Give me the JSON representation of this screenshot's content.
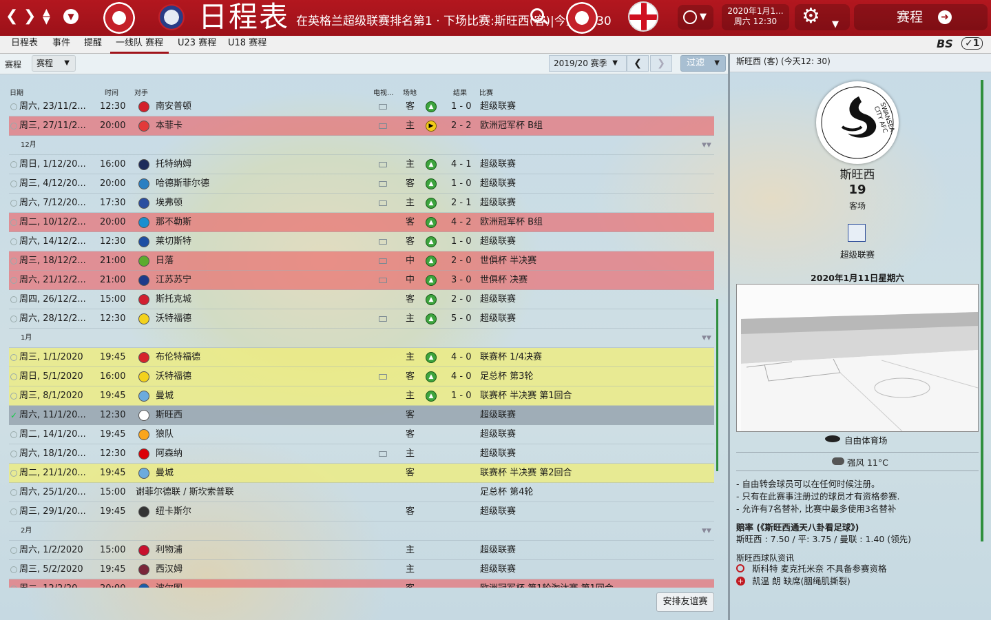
{
  "top": {
    "title": "日程表",
    "status": "在英格兰超级联赛排名第1 · 下场比赛:斯旺西(客)|今天12:30",
    "date_line1": "2020年1月1...",
    "date_line2": "周六 12:30",
    "continue_label": "赛程"
  },
  "tabs": [
    {
      "label": "日程表"
    },
    {
      "label": "事件"
    },
    {
      "label": "提醒"
    },
    {
      "label": "一线队 赛程"
    },
    {
      "label": "U23 赛程"
    },
    {
      "label": "U18 赛程"
    }
  ],
  "toolbar": {
    "view_label": "赛程",
    "view_dropdown": "赛程",
    "season": "2019/20 赛季",
    "filter_label": "过滤"
  },
  "columns": {
    "date": "日期",
    "time": "时间",
    "opponent": "对手",
    "tv": "电视...",
    "venue": "场地",
    "result": "结果",
    "competition": "比赛"
  },
  "rows": [
    {
      "date": "周六, 23/11/2...",
      "time": "12:30",
      "opp": "南安普顿",
      "color": "#d3202a",
      "tv": true,
      "venue": "客",
      "icon": "win",
      "score": "1 - 0",
      "comp": "超级联赛",
      "style": ""
    },
    {
      "date": "周三, 27/11/2...",
      "time": "20:00",
      "opp": "本菲卡",
      "color": "#e33a3a",
      "tv": true,
      "venue": "主",
      "icon": "draw",
      "score": "2 - 2",
      "comp": "欧洲冠军杯 B组",
      "style": "red"
    },
    {
      "month": "12月"
    },
    {
      "date": "周日, 1/12/20...",
      "time": "16:00",
      "opp": "托特纳姆",
      "color": "#1d2b5a",
      "tv": true,
      "venue": "主",
      "icon": "win",
      "score": "4 - 1",
      "comp": "超级联赛",
      "style": ""
    },
    {
      "date": "周三, 4/12/20...",
      "time": "20:00",
      "opp": "哈德斯菲尔德",
      "color": "#2a7fc2",
      "tv": true,
      "venue": "客",
      "icon": "win",
      "score": "1 - 0",
      "comp": "超级联赛",
      "style": ""
    },
    {
      "date": "周六, 7/12/20...",
      "time": "17:30",
      "opp": "埃弗顿",
      "color": "#2a4ea0",
      "tv": true,
      "venue": "主",
      "icon": "win",
      "score": "2 - 1",
      "comp": "超级联赛",
      "style": ""
    },
    {
      "date": "周二, 10/12/2...",
      "time": "20:00",
      "opp": "那不勒斯",
      "color": "#1a8fd0",
      "tv": false,
      "venue": "客",
      "icon": "win",
      "score": "4 - 2",
      "comp": "欧洲冠军杯 B组",
      "style": "red"
    },
    {
      "date": "周六, 14/12/2...",
      "time": "12:30",
      "opp": "莱切斯特",
      "color": "#1d4ea3",
      "tv": true,
      "venue": "客",
      "icon": "win",
      "score": "1 - 0",
      "comp": "超级联赛",
      "style": ""
    },
    {
      "date": "周三, 18/12/2...",
      "time": "21:00",
      "opp": "日落",
      "color": "#5cab2e",
      "tv": true,
      "venue": "中",
      "icon": "win",
      "score": "2 - 0",
      "comp": "世俱杯 半决赛",
      "style": "red"
    },
    {
      "date": "周六, 21/12/2...",
      "time": "21:00",
      "opp": "江苏苏宁",
      "color": "#1d3a8a",
      "tv": true,
      "venue": "中",
      "icon": "win",
      "score": "3 - 0",
      "comp": "世俱杯 决赛",
      "style": "red"
    },
    {
      "date": "周四, 26/12/2...",
      "time": "15:00",
      "opp": "斯托克城",
      "color": "#d22030",
      "tv": false,
      "venue": "客",
      "icon": "win",
      "score": "2 - 0",
      "comp": "超级联赛",
      "style": ""
    },
    {
      "date": "周六, 28/12/2...",
      "time": "12:30",
      "opp": "沃特福德",
      "color": "#f3d21c",
      "tv": true,
      "venue": "主",
      "icon": "win",
      "score": "5 - 0",
      "comp": "超级联赛",
      "style": ""
    },
    {
      "month": "1月"
    },
    {
      "date": "周三, 1/1/2020",
      "time": "19:45",
      "opp": "布伦特福德",
      "color": "#d6242c",
      "tv": false,
      "venue": "主",
      "icon": "win",
      "score": "4 - 0",
      "comp": "联赛杯 1/4决赛",
      "style": "yellow"
    },
    {
      "date": "周日, 5/1/2020",
      "time": "16:00",
      "opp": "沃特福德",
      "color": "#f3d21c",
      "tv": true,
      "venue": "客",
      "icon": "win",
      "score": "4 - 0",
      "comp": "足总杯 第3轮",
      "style": "yellow"
    },
    {
      "date": "周三, 8/1/2020",
      "time": "19:45",
      "opp": "曼城",
      "color": "#6cabdd",
      "tv": false,
      "venue": "主",
      "icon": "win",
      "score": "1 - 0",
      "comp": "联赛杯 半决赛 第1回合",
      "style": "yellow"
    },
    {
      "date": "周六, 11/1/20...",
      "time": "12:30",
      "opp": "斯旺西",
      "color": "#ffffff",
      "tv": false,
      "venue": "客",
      "icon": "",
      "score": "",
      "comp": "超级联赛",
      "style": "sel",
      "checked": true
    },
    {
      "date": "周二, 14/1/20...",
      "time": "19:45",
      "opp": "狼队",
      "color": "#f9a51c",
      "tv": false,
      "venue": "客",
      "icon": "",
      "score": "",
      "comp": "超级联赛",
      "style": ""
    },
    {
      "date": "周六, 18/1/20...",
      "time": "12:30",
      "opp": "阿森纳",
      "color": "#db0007",
      "tv": true,
      "venue": "主",
      "icon": "",
      "score": "",
      "comp": "超级联赛",
      "style": ""
    },
    {
      "date": "周二, 21/1/20...",
      "time": "19:45",
      "opp": "曼城",
      "color": "#6cabdd",
      "tv": false,
      "venue": "客",
      "icon": "",
      "score": "",
      "comp": "联赛杯 半决赛 第2回合",
      "style": "yellow"
    },
    {
      "date": "周六, 25/1/20...",
      "time": "15:00",
      "opp": "谢菲尔德联 / 斯坎索普联",
      "color": "",
      "tv": false,
      "venue": "",
      "icon": "",
      "score": "",
      "comp": "足总杯 第4轮",
      "style": ""
    },
    {
      "date": "周三, 29/1/20...",
      "time": "19:45",
      "opp": "纽卡斯尔",
      "color": "#333333",
      "tv": false,
      "venue": "客",
      "icon": "",
      "score": "",
      "comp": "超级联赛",
      "style": ""
    },
    {
      "month": "2月"
    },
    {
      "date": "周六, 1/2/2020",
      "time": "15:00",
      "opp": "利物浦",
      "color": "#c8102e",
      "tv": false,
      "venue": "主",
      "icon": "",
      "score": "",
      "comp": "超级联赛",
      "style": ""
    },
    {
      "date": "周三, 5/2/2020",
      "time": "19:45",
      "opp": "西汉姆",
      "color": "#7a263a",
      "tv": false,
      "venue": "主",
      "icon": "",
      "score": "",
      "comp": "超级联赛",
      "style": ""
    },
    {
      "date": "周二, 12/2/20...",
      "time": "20:00",
      "opp": "波尔图",
      "color": "#1d5ba8",
      "tv": false,
      "venue": "客",
      "icon": "",
      "score": "",
      "comp": "欧洲冠军杯 第1轮淘汰赛 第1回合",
      "style": "red"
    }
  ],
  "arrange_friendly": "安排友谊赛",
  "right": {
    "header": "斯旺西 (客) (今天12: 30)",
    "team": "斯旺西",
    "position": "19",
    "venue_label": "客场",
    "competition": "超级联赛",
    "date": "2020年1月11日星期六",
    "stadium": "自由体育场",
    "weather": "强风 11°C",
    "notes": [
      "- 自由转会球员可以在任何时候注册。",
      "- 只有在此赛事注册过的球员才有资格参赛.",
      "- 允许有7名替补, 比赛中最多使用3名替补"
    ],
    "odds_title": "赔率 (《斯旺西通天八卦看足球》)",
    "odds": "斯旺西 : 7.50 / 平: 3.75 / 曼联 : 1.40 (领先)",
    "news_title": "斯旺西球队资讯",
    "news": [
      "斯科特 麦克托米奈 不具备参赛资格",
      "凯温 朗 缺席(胭绳肌撕裂)"
    ],
    "logo_text": "SWANSEA CITY AFC"
  },
  "icons": {
    "back": "back-arrow-icon",
    "forward": "forward-arrow-icon",
    "search": "search-icon",
    "settings": "gear-icon",
    "world": "globe-icon"
  },
  "colors": {
    "brand": "#a0141b",
    "win": "#3da43d",
    "draw": "#f2cb1a",
    "european_row": "#ec5f64",
    "cup_row": "#f0ee78"
  }
}
